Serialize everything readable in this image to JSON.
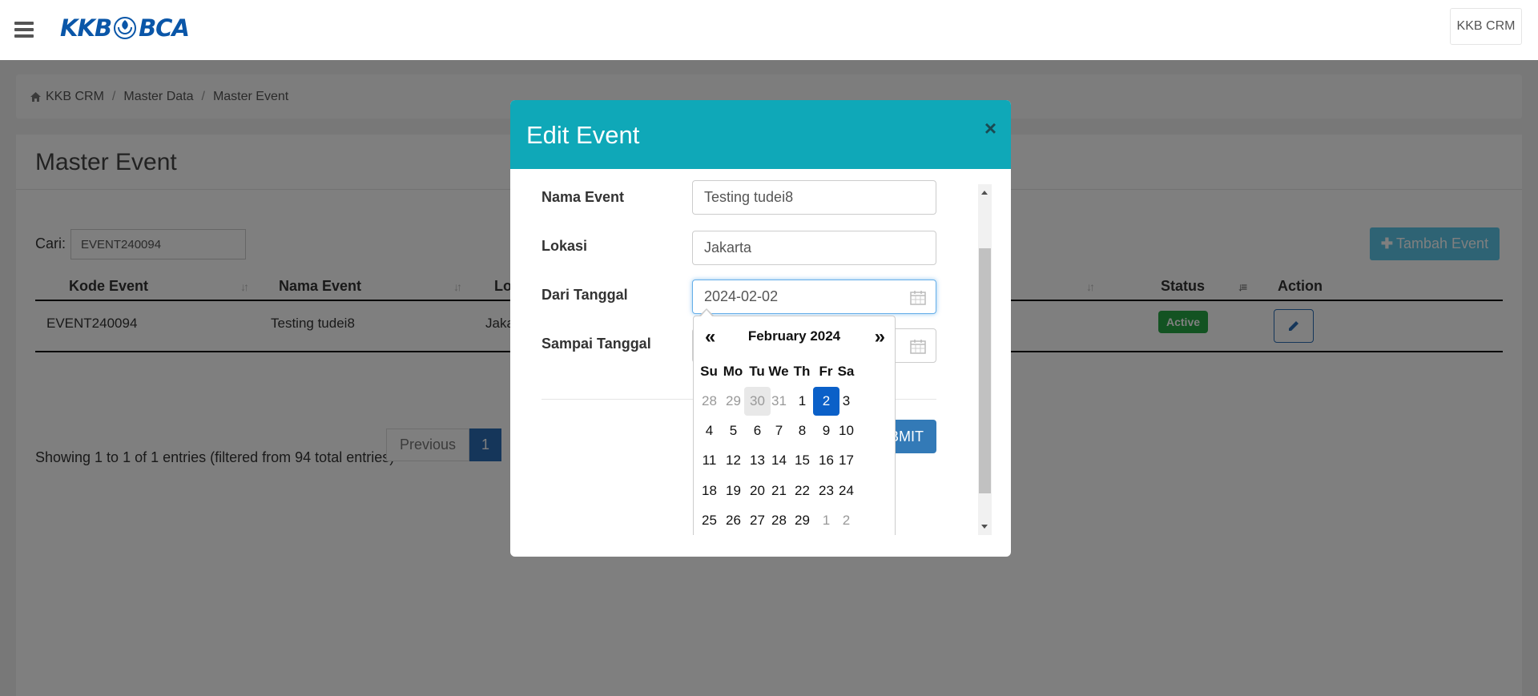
{
  "header": {
    "logo_text_left": "KKB",
    "logo_text_right": "BCA",
    "app_button": "KKB CRM"
  },
  "breadcrumb": [
    "KKB CRM",
    "Master Data",
    "Master Event"
  ],
  "page": {
    "title": "Master Event",
    "search_label": "Cari:",
    "search_value": "EVENT240094",
    "add_button": "Tambah Event"
  },
  "table": {
    "columns": [
      "Kode Event",
      "Nama Event",
      "Lokasi",
      "Status",
      "Action"
    ],
    "rows": [
      {
        "kode": "EVENT240094",
        "nama": "Testing tudei8",
        "lokasi": "Jakarta",
        "status": "Active"
      }
    ],
    "info": "Showing 1 to 1 of 1 entries (filtered from 94 total entries)",
    "pagination": {
      "previous": "Previous",
      "current": "1"
    }
  },
  "modal": {
    "title": "Edit Event",
    "close": "×",
    "fields": {
      "nama_event": {
        "label": "Nama Event",
        "value": "Testing tudei8"
      },
      "lokasi": {
        "label": "Lokasi",
        "value": "Jakarta"
      },
      "dari_tanggal": {
        "label": "Dari Tanggal",
        "value": "2024-02-02"
      },
      "sampai_tanggal": {
        "label": "Sampai Tanggal",
        "value": ""
      }
    },
    "submit": "SUBMIT"
  },
  "datepicker": {
    "prev": "«",
    "next": "»",
    "title": "February 2024",
    "weekdays": [
      "Su",
      "Mo",
      "Tu",
      "We",
      "Th",
      "Fr",
      "Sa"
    ],
    "weeks": [
      [
        "28",
        "29",
        "30",
        "31",
        "1",
        "2",
        "3"
      ],
      [
        "4",
        "5",
        "6",
        "7",
        "8",
        "9",
        "10"
      ],
      [
        "11",
        "12",
        "13",
        "14",
        "15",
        "16",
        "17"
      ],
      [
        "18",
        "19",
        "20",
        "21",
        "22",
        "23",
        "24"
      ],
      [
        "25",
        "26",
        "27",
        "28",
        "29",
        "1",
        "2"
      ]
    ],
    "selected": "2",
    "today": "30"
  },
  "colors": {
    "modal_header": "#0fa8b8",
    "primary": "#337ab7",
    "selected_day": "#0b60c8",
    "status_active": "#27a745",
    "logo": "#0a56a8"
  }
}
